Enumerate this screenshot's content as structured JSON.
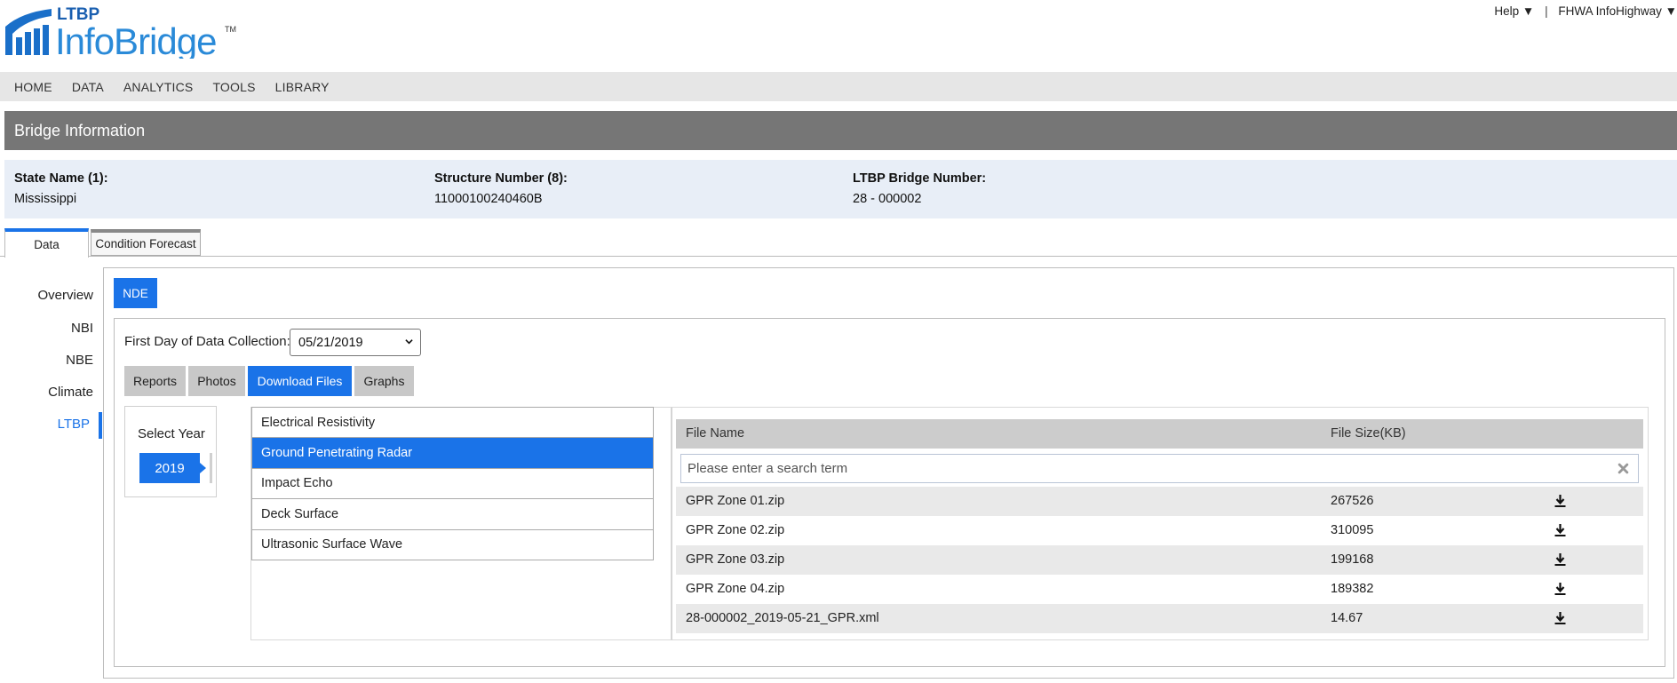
{
  "header": {
    "logo_top": "LTBP",
    "logo_main": "InfoBridge",
    "logo_tm": "TM",
    "help_label": "Help ▼",
    "separator": "|",
    "fhwa_label": "FHWA InfoHighway ▼"
  },
  "nav": {
    "items": [
      {
        "label": "HOME"
      },
      {
        "label": "DATA"
      },
      {
        "label": "ANALYTICS"
      },
      {
        "label": "TOOLS"
      },
      {
        "label": "LIBRARY"
      }
    ]
  },
  "page_title": "Bridge Information",
  "bridge_info": {
    "state_label": "State Name (1):",
    "state_value": "Mississippi",
    "structure_label": "Structure Number (8):",
    "structure_value": "11000100240460B",
    "ltbp_label": "LTBP Bridge Number:",
    "ltbp_value": "28 - 000002"
  },
  "tabs": [
    {
      "label": "Data",
      "active": true
    },
    {
      "label": "Condition Forecast",
      "active": false
    }
  ],
  "sidenav": {
    "items": [
      {
        "label": "Overview"
      },
      {
        "label": "NBI"
      },
      {
        "label": "NBE"
      },
      {
        "label": "Climate"
      },
      {
        "label": "LTBP"
      }
    ],
    "active": "LTBP"
  },
  "nde_button": "NDE",
  "date_filter": {
    "label": "First Day of Data Collection:",
    "selected": "05/21/2019"
  },
  "subtabs": [
    {
      "label": "Reports"
    },
    {
      "label": "Photos"
    },
    {
      "label": "Download Files"
    },
    {
      "label": "Graphs"
    }
  ],
  "active_subtab": "Download Files",
  "year_selector": {
    "title": "Select Year",
    "selected": "2019"
  },
  "methods": [
    {
      "label": "Electrical Resistivity"
    },
    {
      "label": "Ground Penetrating Radar"
    },
    {
      "label": "Impact Echo"
    },
    {
      "label": "Deck Surface"
    },
    {
      "label": "Ultrasonic Surface Wave"
    }
  ],
  "active_method": "Ground Penetrating Radar",
  "files_table": {
    "col_name": "File Name",
    "col_size": "File Size(KB)",
    "search_placeholder": "Please enter a search term",
    "rows": [
      {
        "name": "GPR Zone 01.zip",
        "size": "267526"
      },
      {
        "name": "GPR Zone 02.zip",
        "size": "310095"
      },
      {
        "name": "GPR Zone 03.zip",
        "size": "199168"
      },
      {
        "name": "GPR Zone 04.zip",
        "size": "189382"
      },
      {
        "name": "28-000002_2019-05-21_GPR.xml",
        "size": "14.67"
      }
    ]
  },
  "colors": {
    "accent": "#1a73e8",
    "title_bar": "#767676",
    "nav_bar": "#e6e6e6",
    "info_bar": "#e8eef7"
  },
  "icons": {
    "logo": "infobridge-logo",
    "download": "download-icon",
    "clear": "clear-x-icon",
    "caret": "chevron-down-icon"
  }
}
